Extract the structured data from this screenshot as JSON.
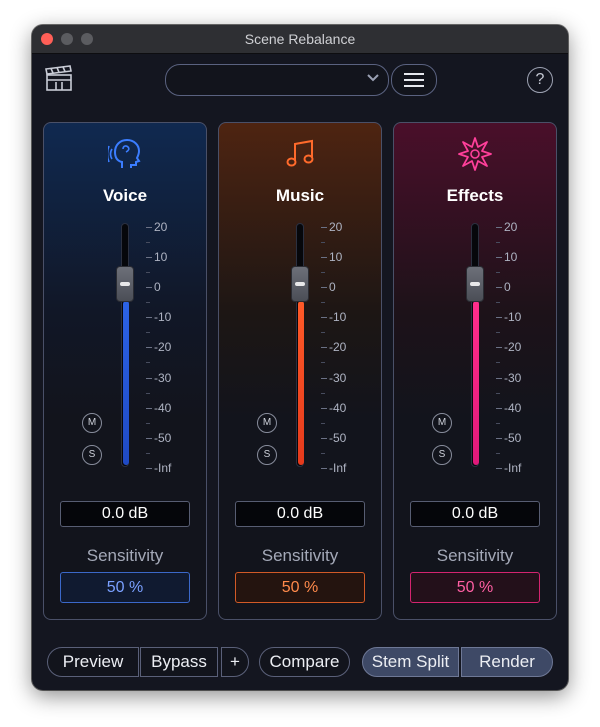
{
  "window": {
    "title": "Scene Rebalance"
  },
  "toolbar": {
    "clapperboard_icon": "clapperboard-icon",
    "preset_value": "",
    "menu_icon": "hamburger-menu-icon",
    "help_label": "?"
  },
  "scale": {
    "major": [
      "20",
      "10",
      "0",
      "-10",
      "-20",
      "-30",
      "-40",
      "-50",
      "-Inf"
    ]
  },
  "channels": [
    {
      "name": "Voice",
      "icon": "speaking-head-icon",
      "color": "#2f6bff",
      "gain": "0.0 dB",
      "gain_db": 0,
      "sensitivity_label": "Sensitivity",
      "sensitivity": "50 %",
      "mute_label": "M",
      "solo_label": "S"
    },
    {
      "name": "Music",
      "icon": "music-note-icon",
      "color": "#ff6a2b",
      "gain": "0.0 dB",
      "gain_db": 0,
      "sensitivity_label": "Sensitivity",
      "sensitivity": "50 %",
      "mute_label": "M",
      "solo_label": "S"
    },
    {
      "name": "Effects",
      "icon": "burst-star-icon",
      "color": "#ff3f9a",
      "gain": "0.0 dB",
      "gain_db": 0,
      "sensitivity_label": "Sensitivity",
      "sensitivity": "50 %",
      "mute_label": "M",
      "solo_label": "S"
    }
  ],
  "bottom": {
    "preview": "Preview",
    "bypass": "Bypass",
    "plus": "+",
    "compare": "Compare",
    "stem_split": "Stem Split",
    "render": "Render"
  }
}
